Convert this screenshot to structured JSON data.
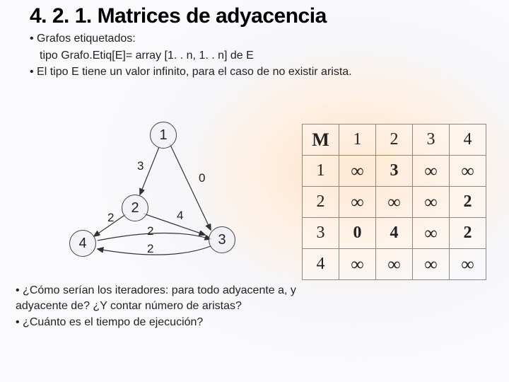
{
  "title": "4. 2. 1. Matrices de adyacencia",
  "bullets": {
    "b1": "Grafos etiquetados:",
    "b1sub": "tipo  Grafo.Etiq[E]= array [1. . n, 1. . n] de E",
    "b2": "El tipo E tiene un valor infinito, para el caso de no existir arista."
  },
  "graph": {
    "nodes": {
      "n1": "1",
      "n2": "2",
      "n3": "3",
      "n4": "4"
    },
    "weights": {
      "w12": "3",
      "w24": "2",
      "w13": "0",
      "w23": "4",
      "w43": "2",
      "w34": "2"
    }
  },
  "matrix": {
    "header": [
      "M",
      "1",
      "2",
      "3",
      "4"
    ],
    "rows": [
      [
        "1",
        "∞",
        "3",
        "∞",
        "∞"
      ],
      [
        "2",
        "∞",
        "∞",
        "∞",
        "2"
      ],
      [
        "3",
        "0",
        "4",
        "∞",
        "2"
      ],
      [
        "4",
        "∞",
        "∞",
        "∞",
        "∞"
      ]
    ]
  },
  "bottom": {
    "q1a": "¿Cómo serían los iteradores: ",
    "q1b": "para todo adyacente a, y adyacente de? ¿Y contar número de aristas?",
    "q2": "¿Cuánto es el tiempo de ejecución?"
  }
}
